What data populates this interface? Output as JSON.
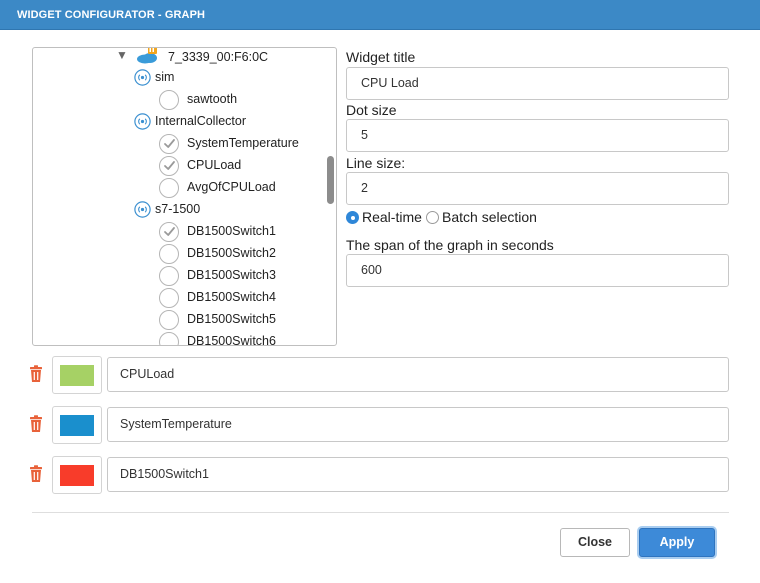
{
  "dialog": {
    "title": "WIDGET CONFIGURATOR - GRAPH"
  },
  "tree": {
    "device": {
      "label": "7_3339_00:F6:0C",
      "expanded": true
    },
    "rows": [
      {
        "kind": "group",
        "label": "sim"
      },
      {
        "kind": "item",
        "label": "sawtooth",
        "checked": false
      },
      {
        "kind": "group",
        "label": "InternalCollector"
      },
      {
        "kind": "item",
        "label": "SystemTemperature",
        "checked": true
      },
      {
        "kind": "item",
        "label": "CPULoad",
        "checked": true
      },
      {
        "kind": "item",
        "label": "AvgOfCPULoad",
        "checked": false
      },
      {
        "kind": "group",
        "label": "s7-1500"
      },
      {
        "kind": "item",
        "label": "DB1500Switch1",
        "checked": true
      },
      {
        "kind": "item",
        "label": "DB1500Switch2",
        "checked": false
      },
      {
        "kind": "item",
        "label": "DB1500Switch3",
        "checked": false
      },
      {
        "kind": "item",
        "label": "DB1500Switch4",
        "checked": false
      },
      {
        "kind": "item",
        "label": "DB1500Switch5",
        "checked": false
      },
      {
        "kind": "item",
        "label": "DB1500Switch6",
        "checked": false
      }
    ]
  },
  "form": {
    "widget_title_label": "Widget title",
    "widget_title_value": "CPU Load",
    "dot_size_label": "Dot size",
    "dot_size_value": "5",
    "line_size_label": "Line size:",
    "line_size_value": "2",
    "mode_realtime_label": "Real-time",
    "mode_batch_label": "Batch selection",
    "mode_selected": "realtime",
    "span_label": "The span of the graph in seconds",
    "span_value": "600"
  },
  "series": [
    {
      "name": "CPULoad",
      "color": "#a6d165"
    },
    {
      "name": "SystemTemperature",
      "color": "#1a8fcd"
    },
    {
      "name": "DB1500Switch1",
      "color": "#f83c2a"
    }
  ],
  "buttons": {
    "close_label": "Close",
    "apply_label": "Apply"
  },
  "icons": {
    "delete": "trash-icon",
    "device": "cloud-device-icon",
    "group": "signal-broadcast-icon",
    "check": "checkmark-icon",
    "expand": "caret-down-icon"
  }
}
